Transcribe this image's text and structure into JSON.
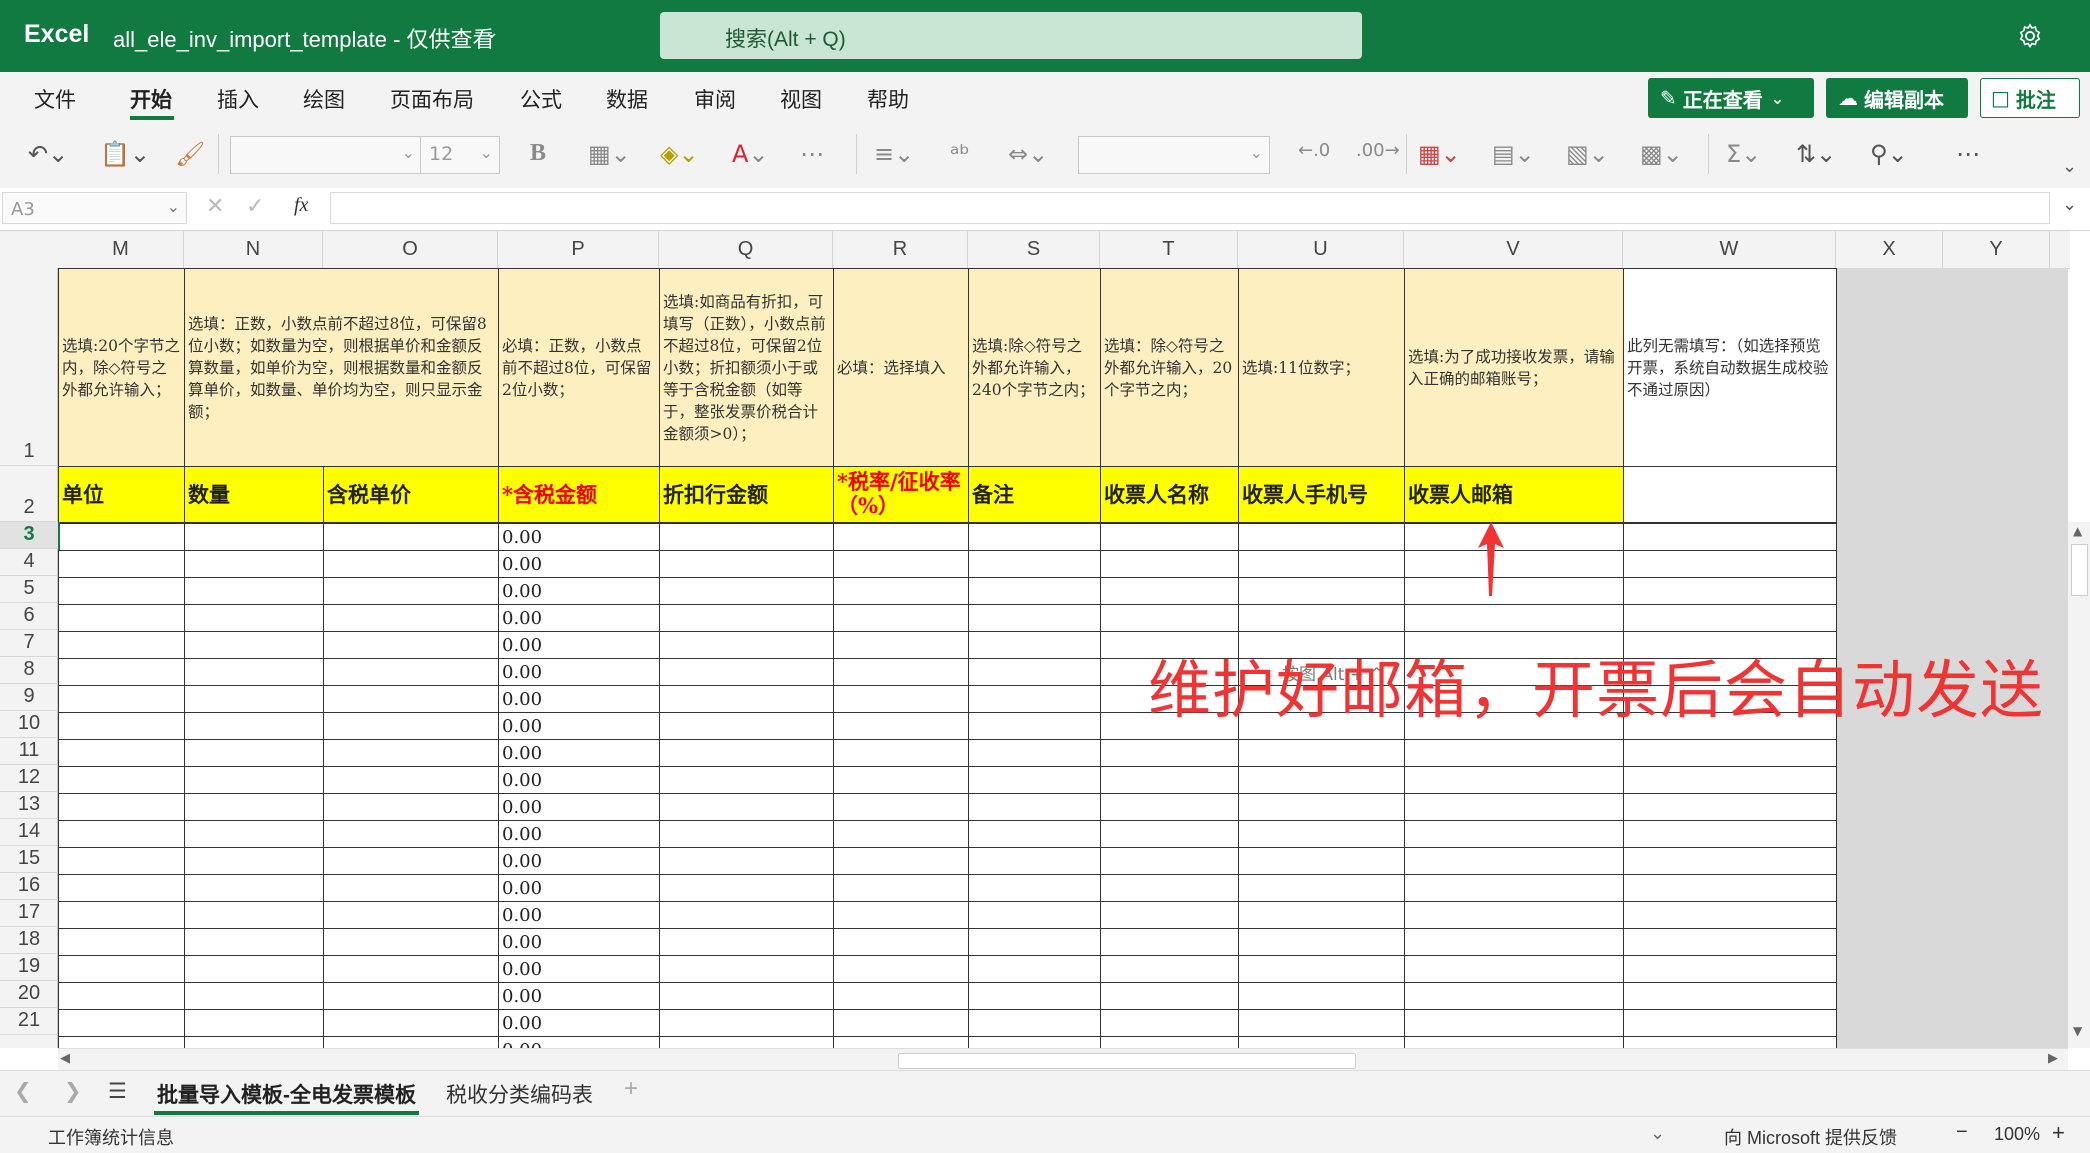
{
  "titlebar": {
    "app": "Excel",
    "doc_title": "all_ele_inv_import_template",
    "mode": "- 仅供查看",
    "search_placeholder": "搜索(Alt + Q)"
  },
  "menu": {
    "tabs": [
      "文件",
      "开始",
      "插入",
      "绘图",
      "页面布局",
      "公式",
      "数据",
      "审阅",
      "视图",
      "帮助"
    ],
    "active_tab": "开始",
    "viewing_button": "正在查看",
    "edit_copy_button": "编辑副本",
    "comment_button": "批注"
  },
  "ribbon": {
    "font_size": "12"
  },
  "formula_bar": {
    "name_box": "A3",
    "fx": "fx",
    "value": ""
  },
  "columns": [
    "M",
    "N",
    "O",
    "P",
    "Q",
    "R",
    "S",
    "T",
    "U",
    "V",
    "W",
    "X",
    "Y"
  ],
  "row_numbers": [
    "1",
    "2",
    "3",
    "4",
    "5",
    "6",
    "7",
    "8",
    "9",
    "10",
    "11",
    "12",
    "13",
    "14",
    "15",
    "16",
    "17",
    "18",
    "19",
    "20",
    "21"
  ],
  "selected_row": "3",
  "sheet": {
    "notes": {
      "M": "选填:20个字节之内，除◇符号之外都允许输入；",
      "NO": "选填：正数，小数点前不超过8位，可保留8位小数；如数量为空，则根据单价和金额反算数量，如单价为空，则根据数量和金额反算单价，如数量、单价均为空，则只显示金额；",
      "P": "必填：正数，小数点前不超过8位，可保留2位小数；",
      "Q": "选填:如商品有折扣，可填写（正数），小数点前不超过8位，可保留2位小数；折扣额须小于或等于含税金额（如等于，整张发票价税合计金额须>0）；",
      "R": "必填：选择填入",
      "S": "选填:除◇符号之外都允许输入，240个字节之内；",
      "T": "选填：除◇符号之外都允许输入，20个字节之内；",
      "U": "选填:11位数字；",
      "V": "选填:为了成功接收发票，请输入正确的邮箱账号；",
      "W": "此列无需填写：（如选择预览开票，系统自动数据生成校验不通过原因）"
    },
    "headers": {
      "M": "单位",
      "N": "数量",
      "O": "含税单价",
      "P": "*含税金额",
      "Q": "折扣行金额",
      "R": "*税率/征收率（%）",
      "S": "备注",
      "T": "收票人名称",
      "U": "收票人手机号",
      "V": "收票人邮箱",
      "W": ""
    },
    "amount_value": "0.00",
    "data_row_count": 20
  },
  "annotation": {
    "text": "维护好邮箱，开票后会自动发送",
    "faint_text": "按图 Alt + ^"
  },
  "sheet_tabs": {
    "tabs": [
      "批量导入模板-全电发票模板",
      "税收分类编码表"
    ],
    "active": "批量导入模板-全电发票模板",
    "add": "+"
  },
  "status": {
    "left": "工作簿统计信息",
    "feedback": "向 Microsoft 提供反馈",
    "zoom": "100%"
  },
  "colors": {
    "brand": "#117a41",
    "note_fill": "#fdefc0",
    "header_fill": "#ffff00",
    "required_text": "#ee0000",
    "annotation": "#f03434"
  }
}
